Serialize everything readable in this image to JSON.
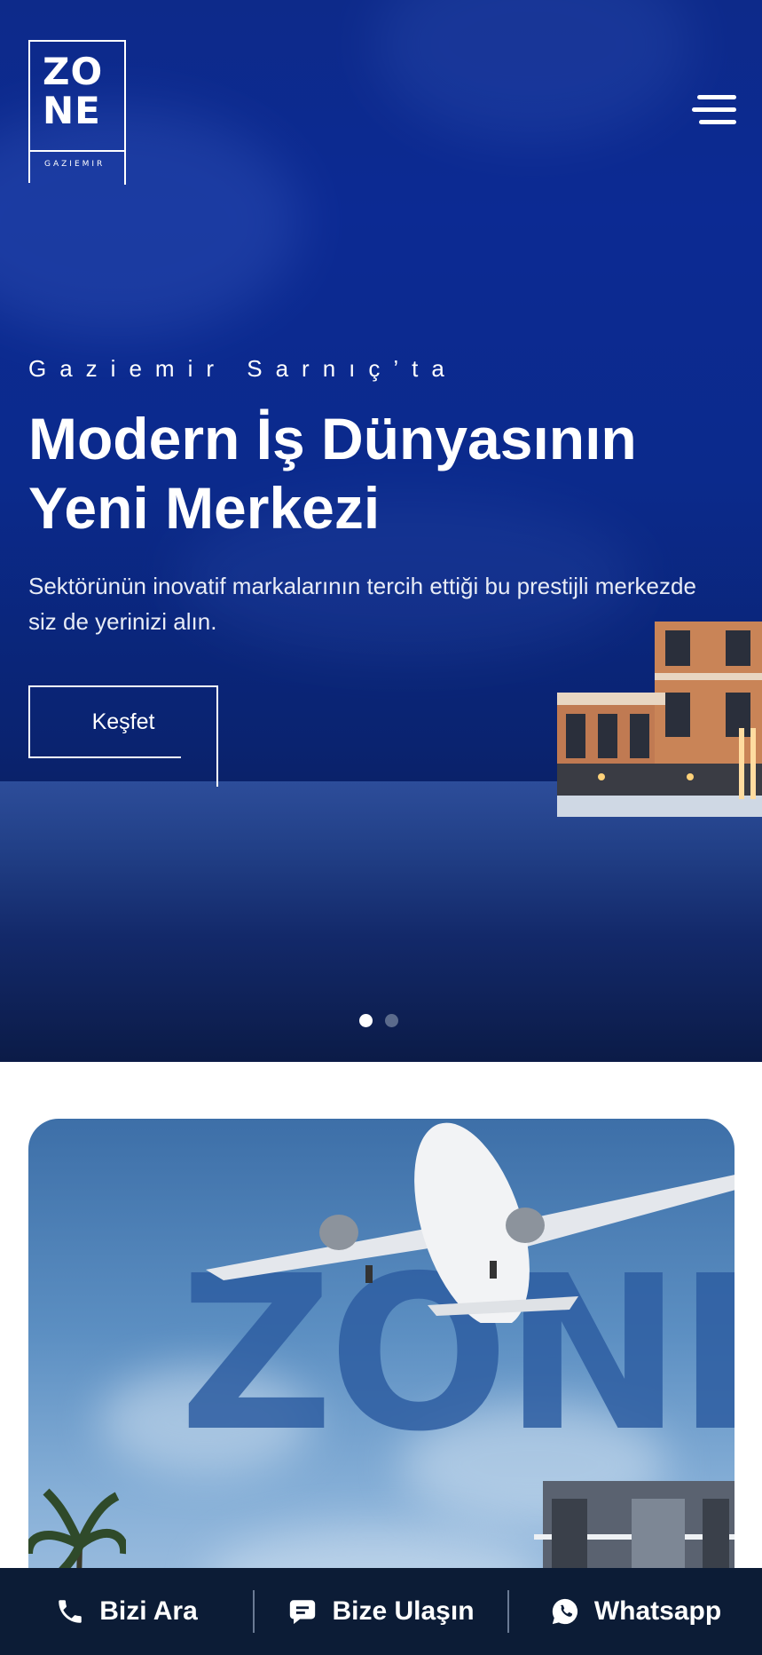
{
  "header": {
    "logo_main": "ZO NE",
    "logo_line1": "ZO",
    "logo_line2": "NE",
    "logo_sub": "GAZIEMIR"
  },
  "hero": {
    "eyebrow": "Gaziemir Sarnıç’ta",
    "title_line1": "Modern İş Dünyasının",
    "title_line2": "Yeni Merkezi",
    "description": "Sektörünün inovatif markalarının tercih ettiği bu prestijli merkezde siz de yerinizi alın.",
    "cta_label": "Keşfet",
    "slides_total": 2,
    "slide_active": 1
  },
  "feature_card": {
    "watermark": "ZONE"
  },
  "bottom_bar": {
    "call_label": "Bizi Ara",
    "contact_label": "Bize Ulaşın",
    "whatsapp_label": "Whatsapp"
  },
  "colors": {
    "hero_blue": "#0c2a93",
    "bar_bg": "#0c1c36",
    "text_white": "#ffffff"
  }
}
